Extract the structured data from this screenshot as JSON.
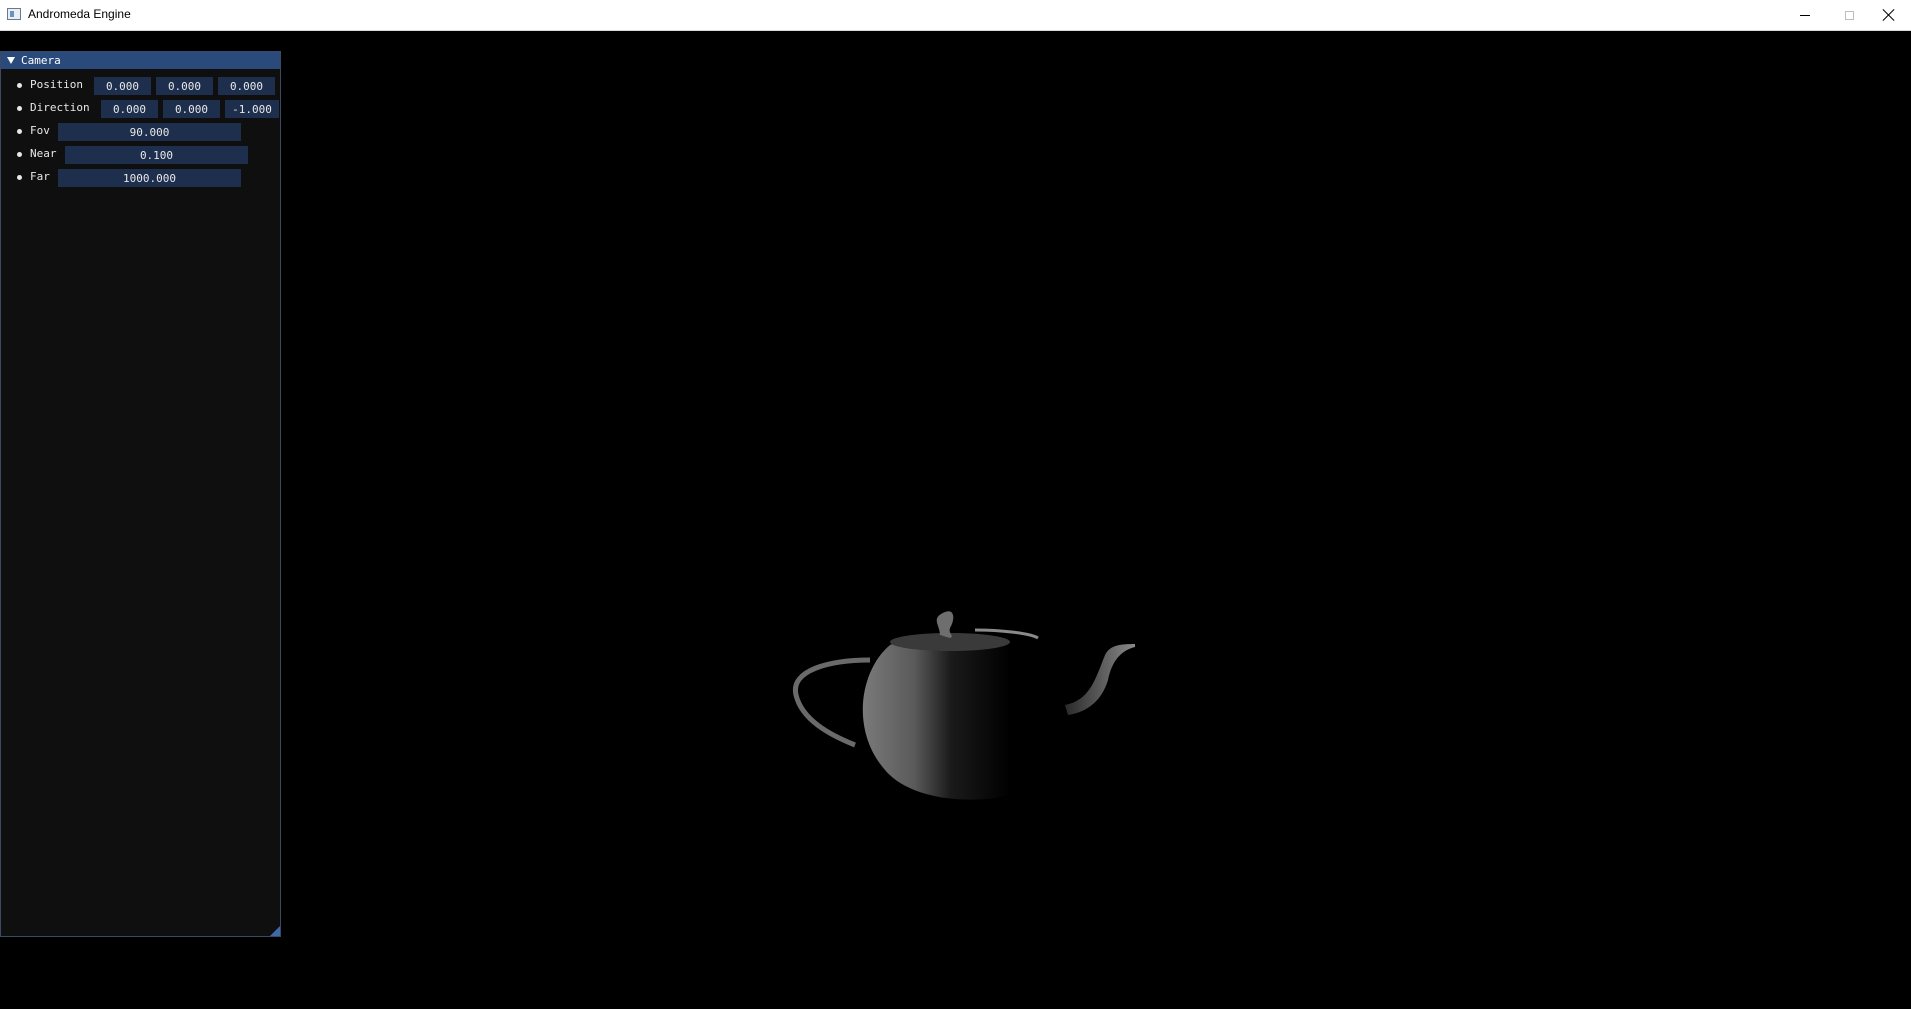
{
  "window": {
    "title": "Andromeda Engine"
  },
  "panel": {
    "title": "Camera",
    "rows": [
      {
        "label": "Position",
        "values": [
          "0.000",
          "0.000",
          "0.000"
        ]
      },
      {
        "label": "Direction",
        "values": [
          "0.000",
          "0.000",
          "-1.000"
        ]
      },
      {
        "label": "Fov",
        "values": [
          "90.000"
        ]
      },
      {
        "label": "Near",
        "values": [
          "0.100"
        ]
      },
      {
        "label": "Far",
        "values": [
          "1000.000"
        ]
      }
    ]
  },
  "colors": {
    "panel_header": "#294a7a",
    "field_bg": "#1d2f4d",
    "panel_bg": "#0f0f0f"
  }
}
